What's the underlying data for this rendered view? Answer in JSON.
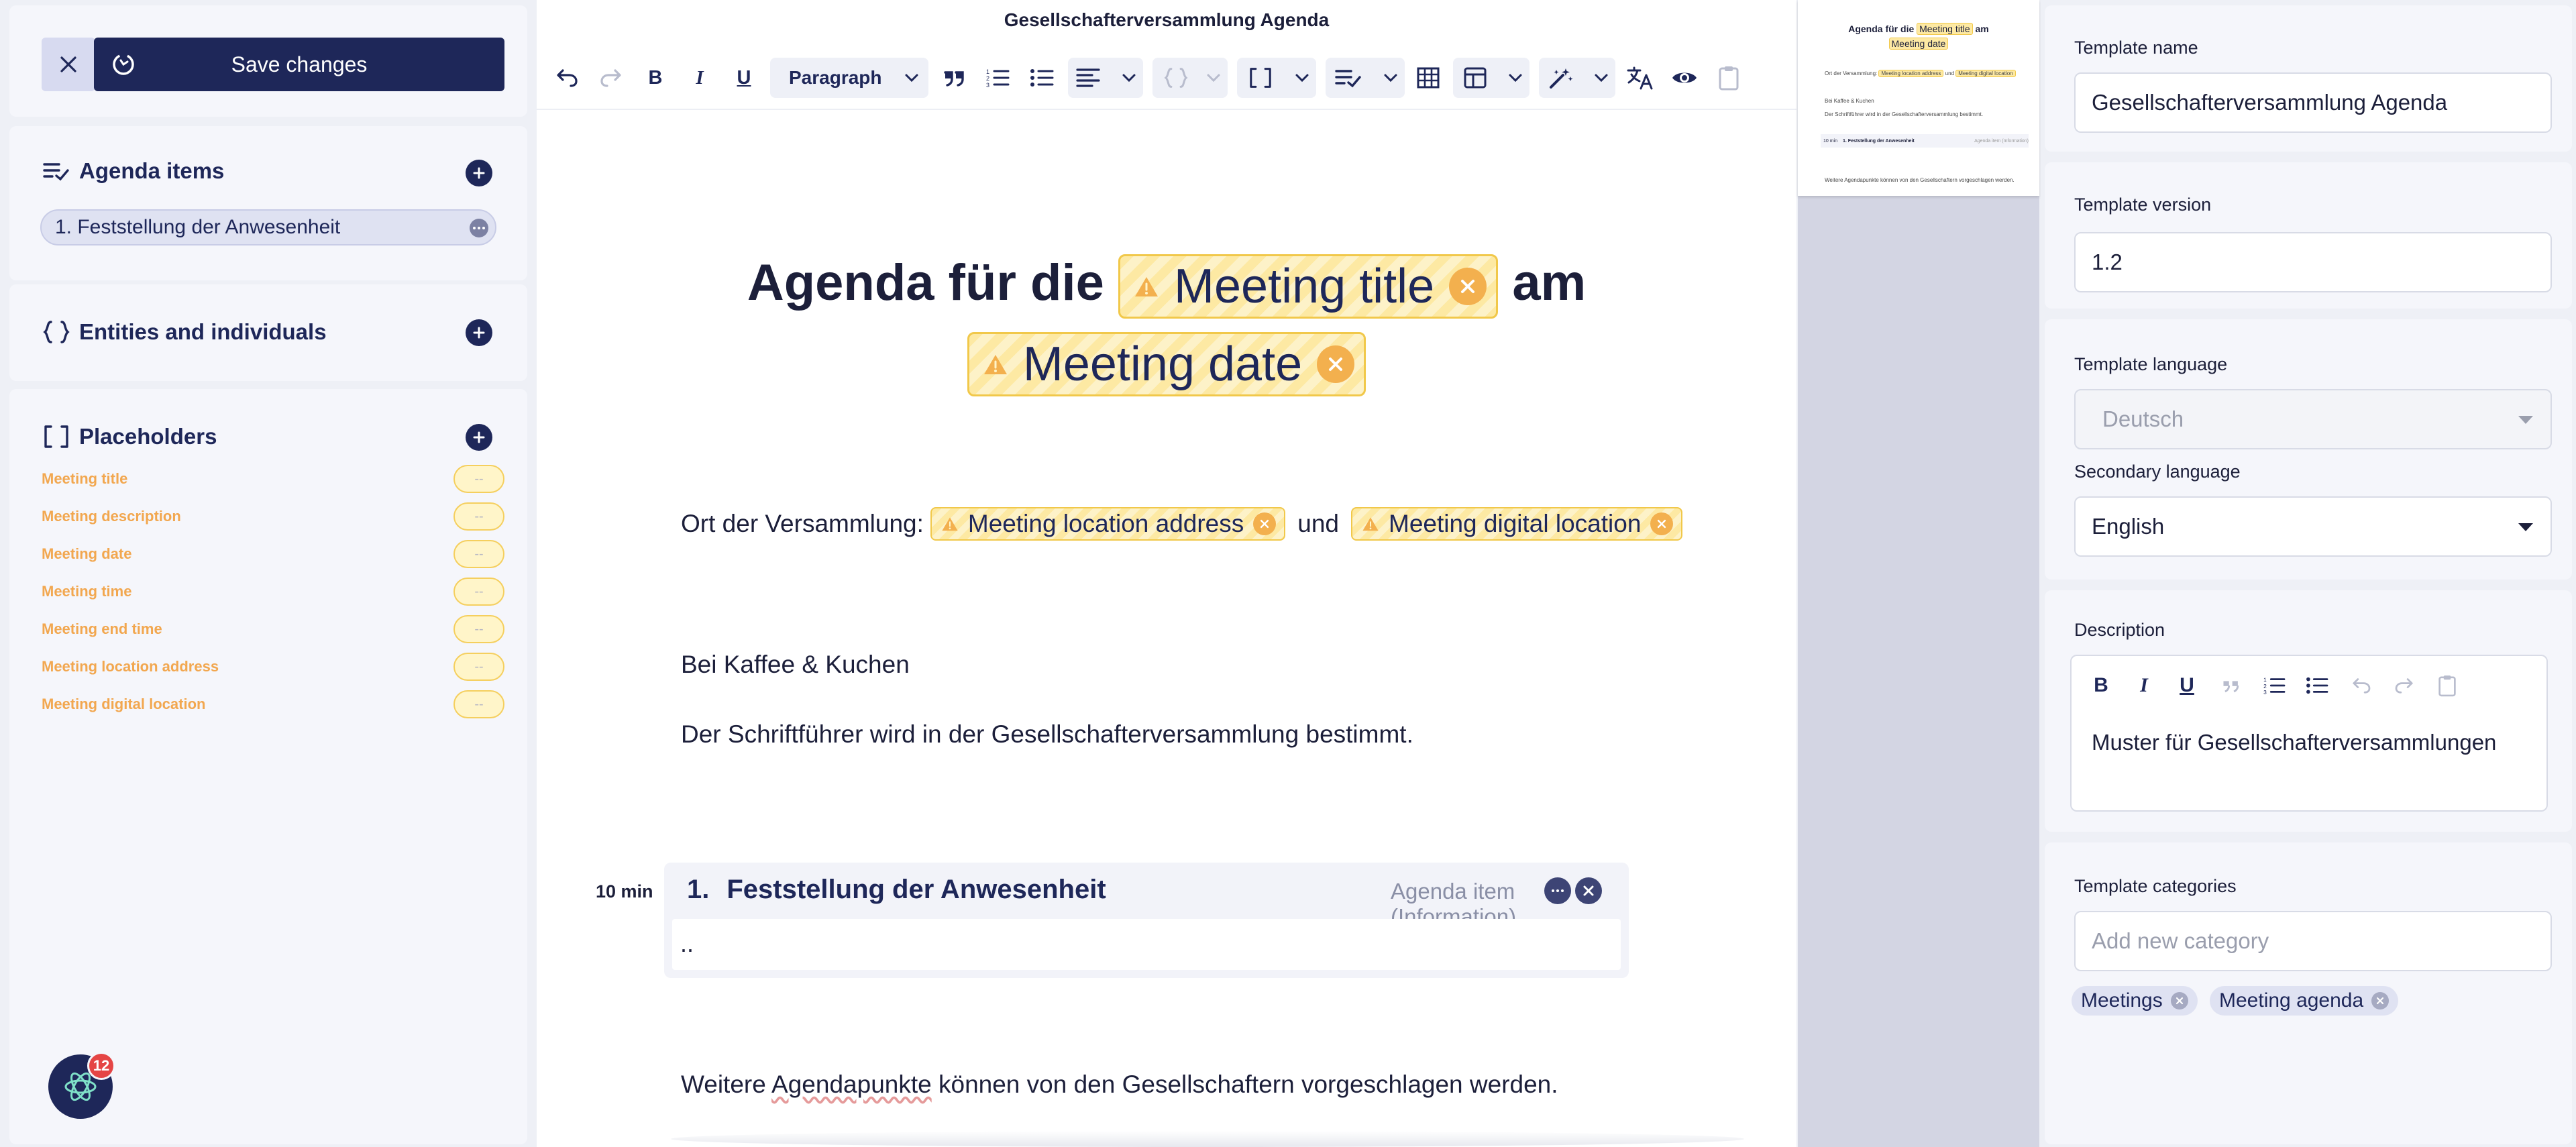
{
  "sidebar": {
    "save_label": "Save changes",
    "agenda_title": "Agenda items",
    "agenda_items": [
      "1. Feststellung der Anwesenheit"
    ],
    "entities_title": "Entities and individuals",
    "placeholders_title": "Placeholders",
    "placeholders": [
      {
        "label": "Meeting title",
        "value": "--"
      },
      {
        "label": "Meeting description",
        "value": "--"
      },
      {
        "label": "Meeting date",
        "value": "--"
      },
      {
        "label": "Meeting time",
        "value": "--"
      },
      {
        "label": "Meeting end time",
        "value": "--"
      },
      {
        "label": "Meeting location address",
        "value": "--"
      },
      {
        "label": "Meeting digital location",
        "value": "--"
      }
    ],
    "notification_count": "12"
  },
  "editor": {
    "doc_title": "Gesellschafterversammlung Agenda",
    "toolbar": {
      "paragraph_style": "Paragraph"
    },
    "heading": {
      "prefix": "Agenda für die",
      "chip_title": "Meeting title",
      "middle": "am",
      "chip_date": "Meeting date"
    },
    "location": {
      "label": "Ort der Versammlung:",
      "chip_address": "Meeting location address",
      "conjunction": "und",
      "chip_digital": "Meeting digital location"
    },
    "para1": "Bei Kaffee & Kuchen",
    "para2": "Der Schriftführer wird in der Gesellschafterversammlung bestimmt.",
    "agenda_item": {
      "duration": "10 min",
      "number": "1.",
      "title": "Feststellung der Anwesenheit",
      "type": "Agenda item (Information)",
      "body": ".."
    },
    "para3_before": "Weitere ",
    "para3_word": "Agendapunkte",
    "para3_after": " können von den Gesellschaftern vorgeschlagen werden."
  },
  "preview": {
    "title_prefix": "Agenda für die",
    "title_chip": "Meeting title",
    "title_mid": "am",
    "date_chip": "Meeting date",
    "line1": "Ort der Versammlung:",
    "line1_chip1": "Meeting location address",
    "line1_mid": "und",
    "line1_chip2": "Meeting digital location",
    "line2": "Bei Kaffee & Kuchen",
    "line3": "Der Schriftführer wird in der Gesellschafterversammlung bestimmt.",
    "item_duration": "10 min",
    "item_title": "1.  Feststellung der Anwesenheit",
    "item_type": "Agenda item (Information)",
    "line4": "Weitere Agendapunkte können von den Gesellschaftern vorgeschlagen werden."
  },
  "settings": {
    "name_label": "Template name",
    "name_value": "Gesellschafterversammlung Agenda",
    "version_label": "Template version",
    "version_value": "1.2",
    "language_label": "Template language",
    "language_value": "Deutsch",
    "secondary_label": "Secondary language",
    "secondary_value": "English",
    "description_label": "Description",
    "description_value": "Muster für Gesellschafterversammlungen",
    "categories_label": "Template categories",
    "categories_placeholder": "Add new category",
    "categories": [
      "Meetings",
      "Meeting agenda"
    ]
  },
  "colors": {
    "navy": "#1e2759",
    "placeholder_orange": "#f2a74f",
    "chip_yellow": "#fde9a3",
    "danger": "#e54545"
  }
}
